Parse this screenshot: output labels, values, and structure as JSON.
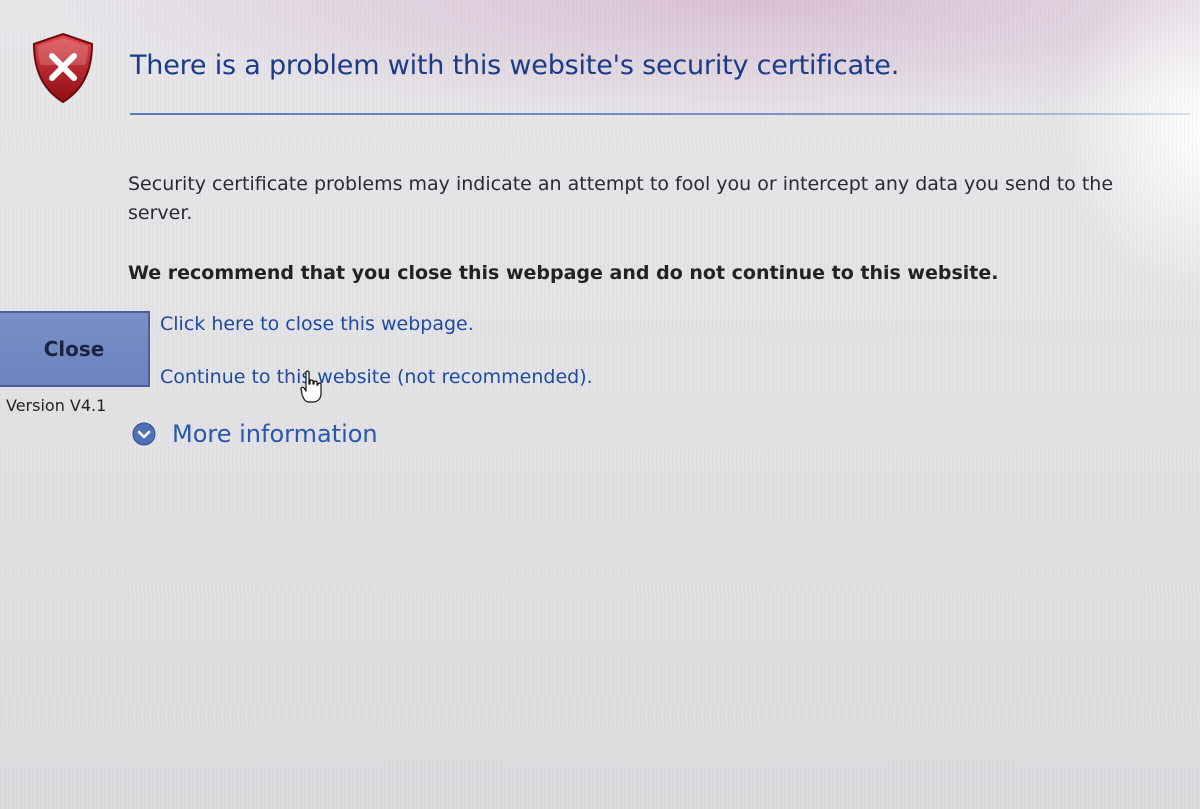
{
  "title": "There is a problem with this website's security certificate.",
  "description": "Security certificate problems may indicate an attempt to fool you or intercept any data you send to the server.",
  "recommendation": "We recommend that you close this webpage and do not continue to this website.",
  "close_button": {
    "label": "Close"
  },
  "version": "Version V4.1",
  "links": {
    "close_webpage": "Click here to close this webpage.",
    "continue_site": "Continue to this website (not recommended)."
  },
  "more_information": {
    "label": "More information",
    "icon": "chevron-down-circle-icon"
  },
  "icons": {
    "shield": "shield-error-icon",
    "cursor": "hand-cursor-icon"
  },
  "colors": {
    "title": "#1a3a8a",
    "link": "#1f4aa0",
    "close_button": "#7890c6",
    "shield": "#b3141c"
  }
}
